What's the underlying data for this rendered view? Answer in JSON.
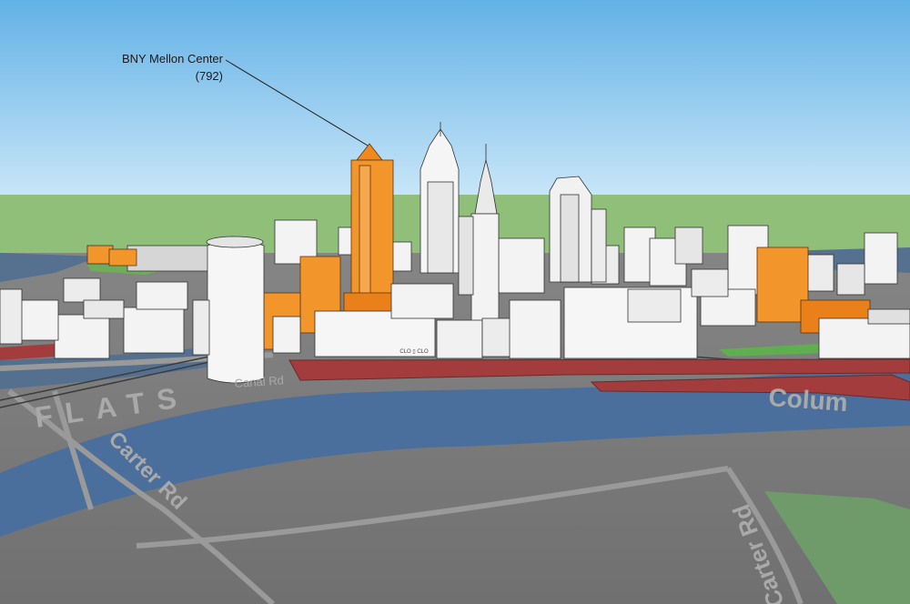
{
  "callout": {
    "name": "BNY Mellon Center",
    "height": "(792)"
  },
  "map_labels": {
    "flats": "FLATS",
    "carter_rd": "Carter Rd",
    "canal_rd": "Canal Rd",
    "carter_rd_right": "Carter Rd",
    "columbus": "Colum"
  },
  "building_signage": "CLO ▯ CLO",
  "colors": {
    "sky_top": "#6fb8e8",
    "sky_bottom": "#c4e4f7",
    "horizon_green": "#90c07a",
    "river": "#4a6f9e",
    "ground": "#7b7b7b",
    "highlight_orange": "#f2952b",
    "building_white": "#f3f3f3",
    "road_red": "#a84040"
  }
}
